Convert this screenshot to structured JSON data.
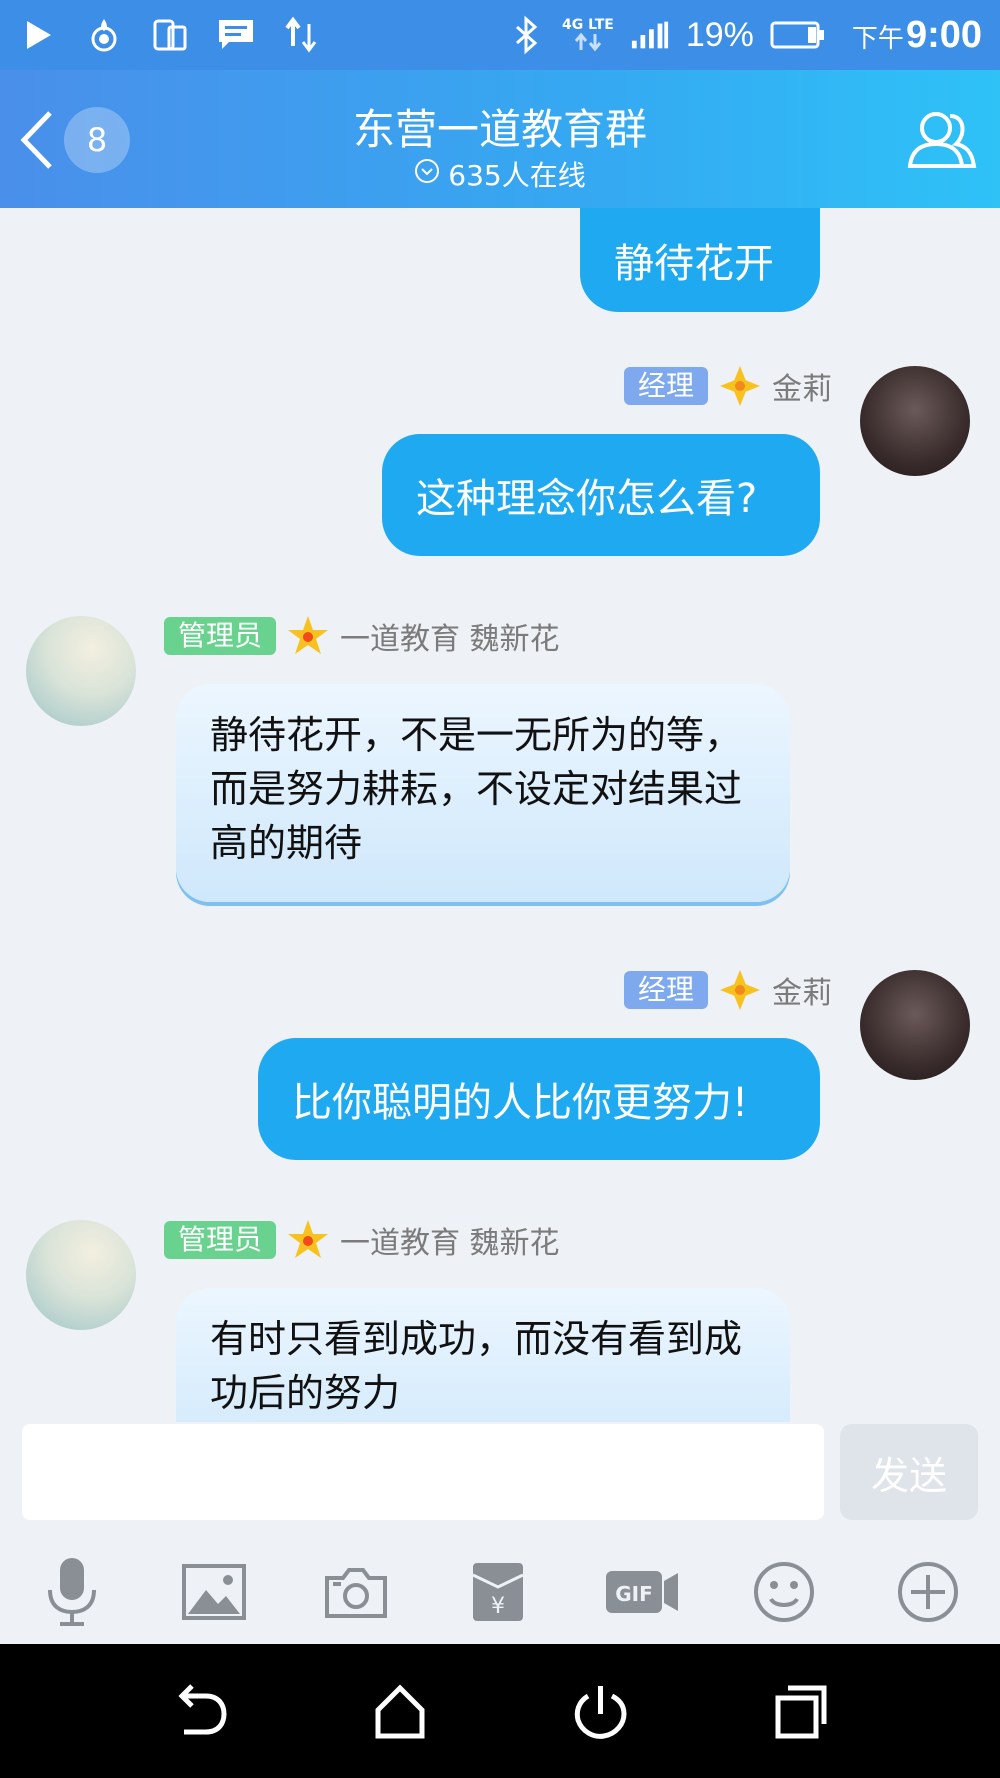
{
  "status_bar": {
    "network_top": "4G LTE",
    "battery": "19%",
    "ampm": "下午",
    "time": "9:00",
    "icons": [
      "play-icon",
      "hotspot-icon",
      "phone-mirror-icon",
      "message-icon",
      "data-transfer-icon",
      "bluetooth-icon",
      "signal-icon",
      "battery-icon"
    ]
  },
  "header": {
    "unread_count": "8",
    "title": "东营一道教育群",
    "online": "635人在线"
  },
  "messages": [
    {
      "side": "me",
      "text": "静待花开"
    },
    {
      "side": "me",
      "role": "经理",
      "name": "金莉",
      "text": "这种理念你怎么看?"
    },
    {
      "side": "other",
      "role": "管理员",
      "name": "一道教育 魏新花",
      "text": "静待花开，不是一无所为的等，而是努力耕耘，不设定对结果过高的期待"
    },
    {
      "side": "me",
      "role": "经理",
      "name": "金莉",
      "text": "比你聪明的人比你更努力!"
    },
    {
      "side": "other",
      "role": "管理员",
      "name": "一道教育 魏新花",
      "text": "有时只看到成功，而没有看到成功后的努力"
    }
  ],
  "input": {
    "value": "",
    "placeholder": "",
    "send_label": "发送"
  },
  "toolbar": [
    "microphone-icon",
    "image-icon",
    "camera-icon",
    "red-packet-icon",
    "gif-icon",
    "emoji-icon",
    "plus-icon"
  ],
  "colors": {
    "header_start": "#4a8fea",
    "header_end": "#2ec2f7",
    "my_bubble": "#1fa9f0",
    "other_bubble": "#d6ecfc",
    "badge_manager": "#7ea9ee",
    "badge_admin": "#69d28e"
  }
}
